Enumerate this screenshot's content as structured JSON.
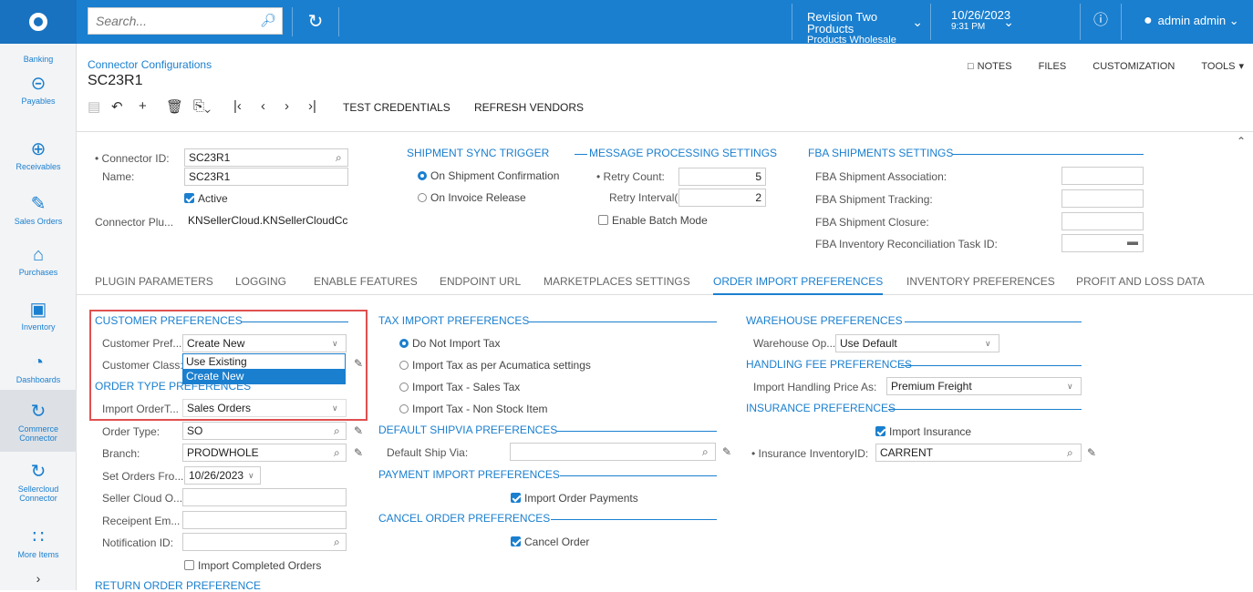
{
  "topbar": {
    "search_placeholder": "Search...",
    "company_name": "Revision Two Products",
    "company_branch": "Products Wholesale",
    "date": "10/26/2023",
    "time": "9:31 PM",
    "user": "admin admin"
  },
  "sidebar": [
    {
      "label": "Banking",
      "icon": "bank-icon"
    },
    {
      "label": "Payables",
      "icon": "minus-circle-icon"
    },
    {
      "label": "Receivables",
      "icon": "plus-circle-icon"
    },
    {
      "label": "Sales Orders",
      "icon": "pencil-box-icon"
    },
    {
      "label": "Purchases",
      "icon": "cart-icon"
    },
    {
      "label": "Inventory",
      "icon": "truck-icon"
    },
    {
      "label": "Dashboards",
      "icon": "gauge-icon"
    },
    {
      "label": "Commerce Connector",
      "icon": "sync-icon"
    },
    {
      "label": "Sellercloud Connector",
      "icon": "sync-icon"
    },
    {
      "label": "More Items",
      "icon": "grid-icon"
    }
  ],
  "header": {
    "breadcrumb": "Connector Configurations",
    "title": "SC23R1",
    "actions": [
      "NOTES",
      "FILES",
      "CUSTOMIZATION",
      "TOOLS"
    ]
  },
  "toolbar": {
    "test_credentials": "TEST CREDENTIALS",
    "refresh_vendors": "REFRESH VENDORS"
  },
  "summary": {
    "connector_id_label": "• Connector ID:",
    "connector_id": "SC23R1",
    "name_label": "Name:",
    "name": "SC23R1",
    "active_label": "Active",
    "plugin_label": "Connector Plu...",
    "plugin": "KNSellerCloud.KNSellerCloudCc",
    "shipment_sync_title": "SHIPMENT SYNC TRIGGER",
    "on_shipment": "On Shipment Confirmation",
    "on_invoice": "On Invoice Release",
    "msg_title": "MESSAGE PROCESSING SETTINGS",
    "retry_count_label": "• Retry Count:",
    "retry_count": "5",
    "retry_interval_label": "Retry Interval(...",
    "retry_interval": "2",
    "batch_label": "Enable Batch Mode",
    "fba_title": "FBA SHIPMENTS SETTINGS",
    "fba_assoc": "FBA Shipment Association:",
    "fba_tracking": "FBA Shipment Tracking:",
    "fba_closure": "FBA Shipment Closure:",
    "fba_recon": "FBA Inventory Reconciliation Task ID:"
  },
  "tabs": [
    "PLUGIN PARAMETERS",
    "LOGGING",
    "ENABLE FEATURES",
    "ENDPOINT URL",
    "MARKETPLACES SETTINGS",
    "ORDER IMPORT PREFERENCES",
    "INVENTORY PREFERENCES",
    "PROFIT AND LOSS DATA"
  ],
  "order_import": {
    "customer_pref_title": "CUSTOMER PREFERENCES",
    "customer_pref_label": "Customer Pref...",
    "customer_pref_value": "Create New",
    "customer_class_label": "Customer Class:",
    "dropdown_options": [
      "Use Existing",
      "Create New"
    ],
    "order_type_title": "ORDER TYPE PREFERENCES",
    "import_order_type_label": "Import OrderT...",
    "import_order_type": "Sales Orders",
    "order_type_label": "Order Type:",
    "order_type": "SO",
    "branch_label": "Branch:",
    "branch": "PRODWHOLE",
    "set_orders_label": "Set Orders Fro...",
    "set_orders_date": "10/26/2023",
    "seller_cloud_label": "Seller Cloud O...",
    "receipient_label": "Receipent Em...",
    "notification_label": "Notification ID:",
    "import_completed_label": "Import Completed Orders",
    "return_order_title": "RETURN ORDER PREFERENCE",
    "tax_title": "TAX IMPORT PREFERENCES",
    "tax_opts": [
      "Do Not Import Tax",
      "Import Tax as per Acumatica settings",
      "Import Tax - Sales Tax",
      "Import Tax - Non Stock Item"
    ],
    "shipvia_title": "DEFAULT SHIPVIA PREFERENCES",
    "ship_via_label": "Default Ship Via:",
    "payment_title": "PAYMENT IMPORT PREFERENCES",
    "import_payments_label": "Import Order Payments",
    "cancel_title": "CANCEL ORDER PREFERENCES",
    "cancel_label": "Cancel Order",
    "warehouse_title": "WAREHOUSE PREFERENCES",
    "warehouse_label": "Warehouse Op...",
    "warehouse_value": "Use Default",
    "handling_title": "HANDLING FEE PREFERENCES",
    "handling_label": "Import Handling Price As:",
    "handling_value": "Premium Freight",
    "insurance_title": "INSURANCE PREFERENCES",
    "import_insurance_label": "Import Insurance",
    "insurance_inv_label": "• Insurance InventoryID:",
    "insurance_inv_value": "CARRENT"
  }
}
